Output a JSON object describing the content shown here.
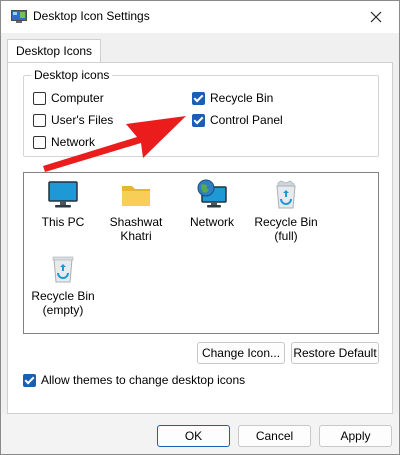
{
  "window": {
    "title": "Desktop Icon Settings"
  },
  "tab": {
    "label": "Desktop Icons"
  },
  "group": {
    "legend": "Desktop icons",
    "checkboxes": [
      {
        "label": "Computer",
        "checked": false
      },
      {
        "label": "User's Files",
        "checked": false
      },
      {
        "label": "Network",
        "checked": false
      },
      {
        "label": "Recycle Bin",
        "checked": true
      },
      {
        "label": "Control Panel",
        "checked": true
      }
    ]
  },
  "icons": [
    {
      "label": "This PC",
      "icon": "monitor-icon"
    },
    {
      "label": "Shashwat Khatri",
      "icon": "folder-icon"
    },
    {
      "label": "Network",
      "icon": "network-globe-icon"
    },
    {
      "label": "Recycle Bin (full)",
      "icon": "recycle-bin-full-icon"
    },
    {
      "label": "Recycle Bin (empty)",
      "icon": "recycle-bin-empty-icon"
    }
  ],
  "buttons": {
    "change_icon": "Change Icon...",
    "restore_default": "Restore Default",
    "ok": "OK",
    "cancel": "Cancel",
    "apply": "Apply"
  },
  "allow_themes": {
    "label": "Allow themes to change desktop icons",
    "checked": true
  },
  "colors": {
    "accent": "#1b5fb4",
    "annotation_arrow": "#ea1c1c"
  }
}
